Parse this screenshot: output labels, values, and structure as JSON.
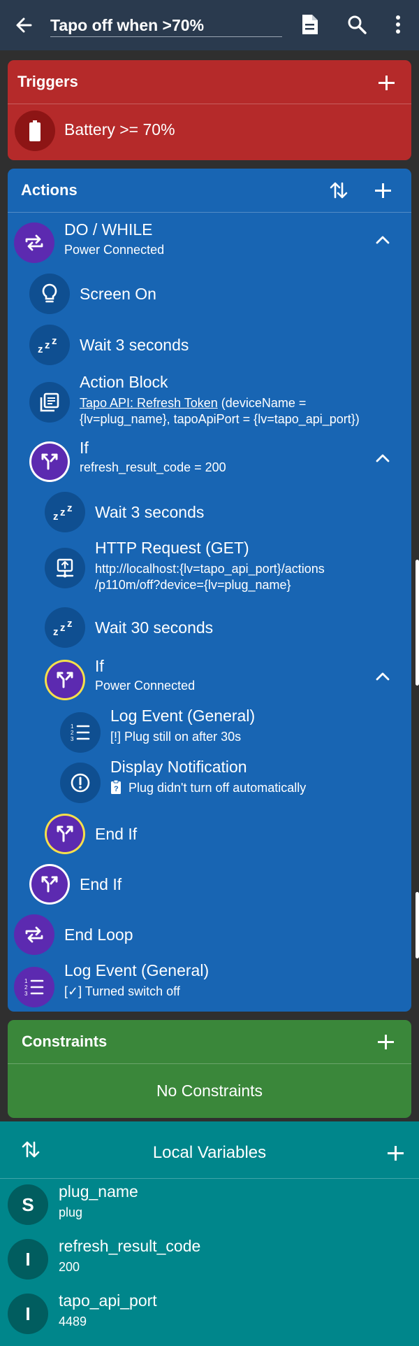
{
  "app_bar": {
    "title": "Tapo off when >70%",
    "icons": [
      "back-arrow-icon",
      "document-icon",
      "search-icon",
      "more-vertical-icon"
    ]
  },
  "triggers": {
    "title": "Triggers",
    "items": [
      {
        "icon": "battery-icon",
        "label": "Battery >= 70%"
      }
    ]
  },
  "actions": {
    "title": "Actions",
    "items": [
      {
        "icon": "loop-icon",
        "label": "DO / WHILE",
        "detail": "Power Connected",
        "indent": 0
      },
      {
        "icon": "lightbulb-icon",
        "label": "Screen On",
        "detail": "",
        "indent": 1
      },
      {
        "icon": "sleep-icon",
        "label": "Wait 3 seconds",
        "detail": "",
        "indent": 1
      },
      {
        "icon": "action-block-icon",
        "label": "Action Block",
        "detail_link": "Tapo API: Refresh Token",
        "detail_rest": " (deviceName =",
        "detail_line2": "{lv=plug_name}, tapoApiPort = {lv=tapo_api_port})",
        "indent": 1
      },
      {
        "icon": "if-branch-icon",
        "label": "If",
        "detail": "refresh_result_code = 200",
        "indent": 1
      },
      {
        "icon": "sleep-icon",
        "label": "Wait 3 seconds",
        "detail": "",
        "indent": 2
      },
      {
        "icon": "http-request-icon",
        "label": "HTTP Request (GET)",
        "detail": "http://localhost:{lv=tapo_api_port}/actions",
        "detail_line2": "/p110m/off?device={lv=plug_name}",
        "indent": 2
      },
      {
        "icon": "sleep-icon",
        "label": "Wait 30 seconds",
        "detail": "",
        "indent": 2
      },
      {
        "icon": "if-branch-icon",
        "label": "If",
        "detail": "Power Connected",
        "indent": 2
      },
      {
        "icon": "log-list-icon",
        "label": "Log Event (General)",
        "detail": "[!] Plug still on after 30s",
        "indent": 3
      },
      {
        "icon": "alert-circle-icon",
        "label": "Display Notification",
        "detail": "Plug didn't turn off automatically",
        "indent": 3
      },
      {
        "icon": "if-branch-icon",
        "label": "End If",
        "detail": "",
        "indent": 2
      },
      {
        "icon": "if-branch-icon",
        "label": "End If",
        "detail": "",
        "indent": 1
      },
      {
        "icon": "loop-icon",
        "label": "End Loop",
        "detail": "",
        "indent": 0
      },
      {
        "icon": "log-list-icon",
        "label": "Log Event (General)",
        "detail": "[✓] Turned switch off",
        "indent": 0
      }
    ]
  },
  "constraints": {
    "title": "Constraints",
    "empty_text": "No Constraints"
  },
  "local_variables": {
    "title": "Local Variables",
    "items": [
      {
        "type": "S",
        "name": "plug_name",
        "value": "plug"
      },
      {
        "type": "I",
        "name": "refresh_result_code",
        "value": "200"
      },
      {
        "type": "I",
        "name": "tapo_api_port",
        "value": "4489"
      }
    ]
  },
  "colors": {
    "app_bar": "#2a3a4e",
    "triggers": "#b52a2a",
    "actions": "#1865b3",
    "constraints": "#3a873a",
    "local_variables": "#00868b",
    "if_ring_outer": "#ffffff",
    "if_ring_inner": "#f4e14b"
  }
}
